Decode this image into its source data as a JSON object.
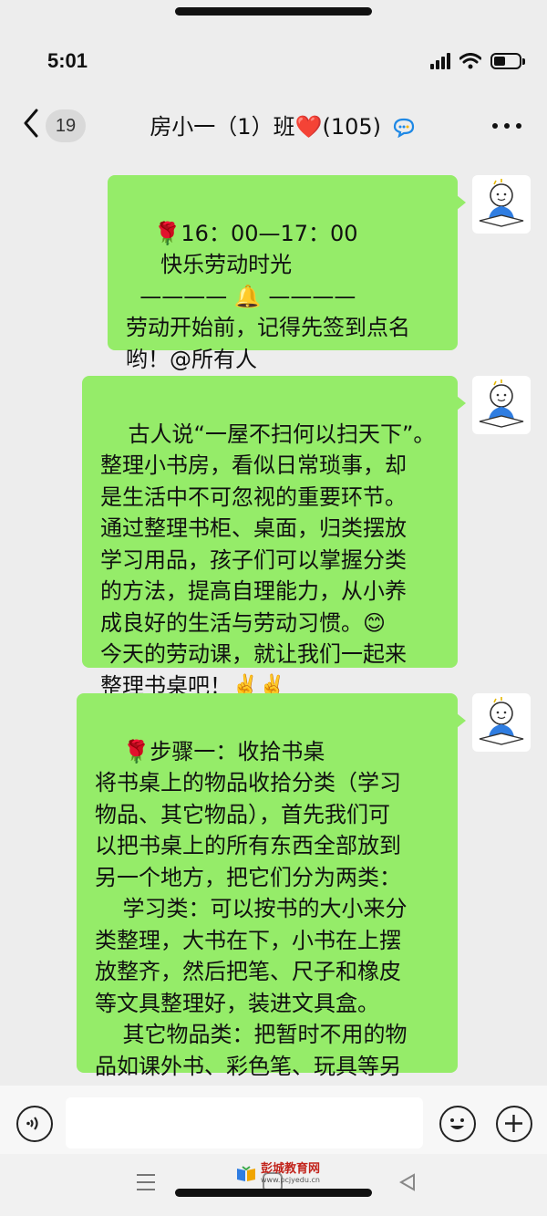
{
  "status": {
    "time": "5:01"
  },
  "header": {
    "back_count": "19",
    "title": "房小一（1）班",
    "heart": "❤️",
    "member_count": "(105)"
  },
  "messages": [
    {
      "rose": "🌹",
      "head": "16：00—17：00",
      "text": "\n     快乐劳动时光\n  ———— 🔔 ————\n劳动开始前，记得先签到点名\n哟！@所有人"
    },
    {
      "rose": "",
      "head": "",
      "text": "古人说“一屋不扫何以扫天下”。\n整理小书房，看似日常琐事，却\n是生活中不可忽视的重要环节。\n通过整理书柜、桌面，归类摆放\n学习用品，孩子们可以掌握分类\n的方法，提高自理能力，从小养\n成良好的生活与劳动习惯。😊\n今天的劳动课，就让我们一起来\n整理书桌吧！✌️✌️"
    },
    {
      "rose": "🌹",
      "head": "步骤一：收拾书桌",
      "text": "\n将书桌上的物品收拾分类（学习\n物品、其它物品），首先我们可\n以把书桌上的所有东西全部放到\n另一个地方，把它们分为两类：\n    学习类：可以按书的大小来分\n类整理，大书在下，小书在上摆\n放整齐，然后把笔、尺子和橡皮\n等文具整理好，装进文具盒。\n    其它物品类：把暂时不用的物\n品如课外书、彩色笔、玩具等另\n外放置其它位置，摆放整齐。"
    }
  ],
  "watermark": {
    "brand": "彭城教育网",
    "url": "www.pcjyedu.cn"
  },
  "icons": [
    "back-icon",
    "chat-bubble-icon",
    "more-icon",
    "voice-icon",
    "emoji-icon",
    "plus-icon",
    "menu-icon",
    "home-icon",
    "back-triangle-icon"
  ],
  "colors": {
    "bubble": "#95ec69",
    "background": "#ededed"
  }
}
